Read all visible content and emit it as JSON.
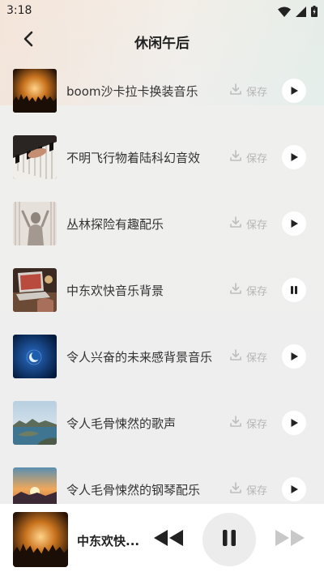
{
  "status_bar": {
    "time": "3:18",
    "icons": [
      "wifi-icon",
      "signal-icon",
      "battery-icon"
    ]
  },
  "header": {
    "title": "休闲午后",
    "back_icon": "chevron-left-icon"
  },
  "tracks": [
    {
      "name": "boom沙卡拉卡换装音乐",
      "save_label": "保存",
      "state": "play",
      "thumb": "concert-crowd"
    },
    {
      "name": "不明飞行物着陆科幻音效",
      "save_label": "保存",
      "state": "play",
      "thumb": "piano-keys"
    },
    {
      "name": "丛林探险有趣配乐",
      "save_label": "保存",
      "state": "play",
      "thumb": "figure-behind-curtain"
    },
    {
      "name": "中东欢快音乐背景",
      "save_label": "保存",
      "state": "pause",
      "thumb": "laptop-desk"
    },
    {
      "name": "令人兴奋的未来感背景音乐",
      "save_label": "保存",
      "state": "play",
      "thumb": "blue-moon"
    },
    {
      "name": "令人毛骨悚然的歌声",
      "save_label": "保存",
      "state": "play",
      "thumb": "coastal-islands"
    },
    {
      "name": "令人毛骨悚然的钢琴配乐",
      "save_label": "保存",
      "state": "play",
      "thumb": "sunset"
    }
  ],
  "player": {
    "title": "中东欢快...",
    "thumb": "concert-crowd",
    "state": "playing"
  }
}
